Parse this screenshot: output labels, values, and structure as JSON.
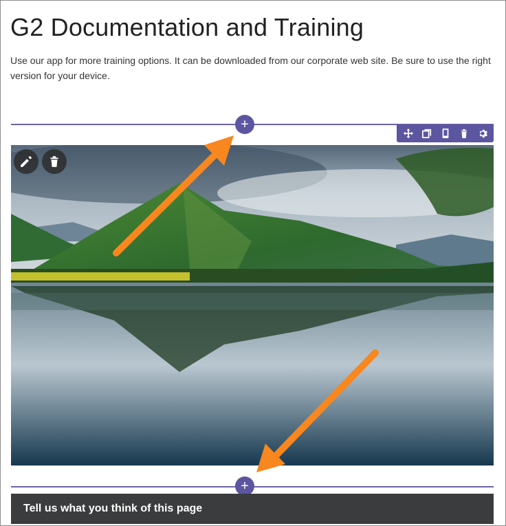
{
  "page": {
    "title": "G2 Documentation and Training",
    "intro": "Use our app for more training options. It can be downloaded from our corporate web site. Be sure to use the right version for your device."
  },
  "editor": {
    "add_label": "+",
    "toolbar_icons": [
      "move-icon",
      "duplicate-icon",
      "mobile-icon",
      "trash-icon",
      "settings-icon"
    ],
    "image_controls": [
      "pencil-icon",
      "trash-icon"
    ],
    "accent_color": "#5c55a0"
  },
  "feedback": {
    "label": "Tell us what you think of this page"
  },
  "annotation": {
    "arrow_color": "#f7871e"
  }
}
